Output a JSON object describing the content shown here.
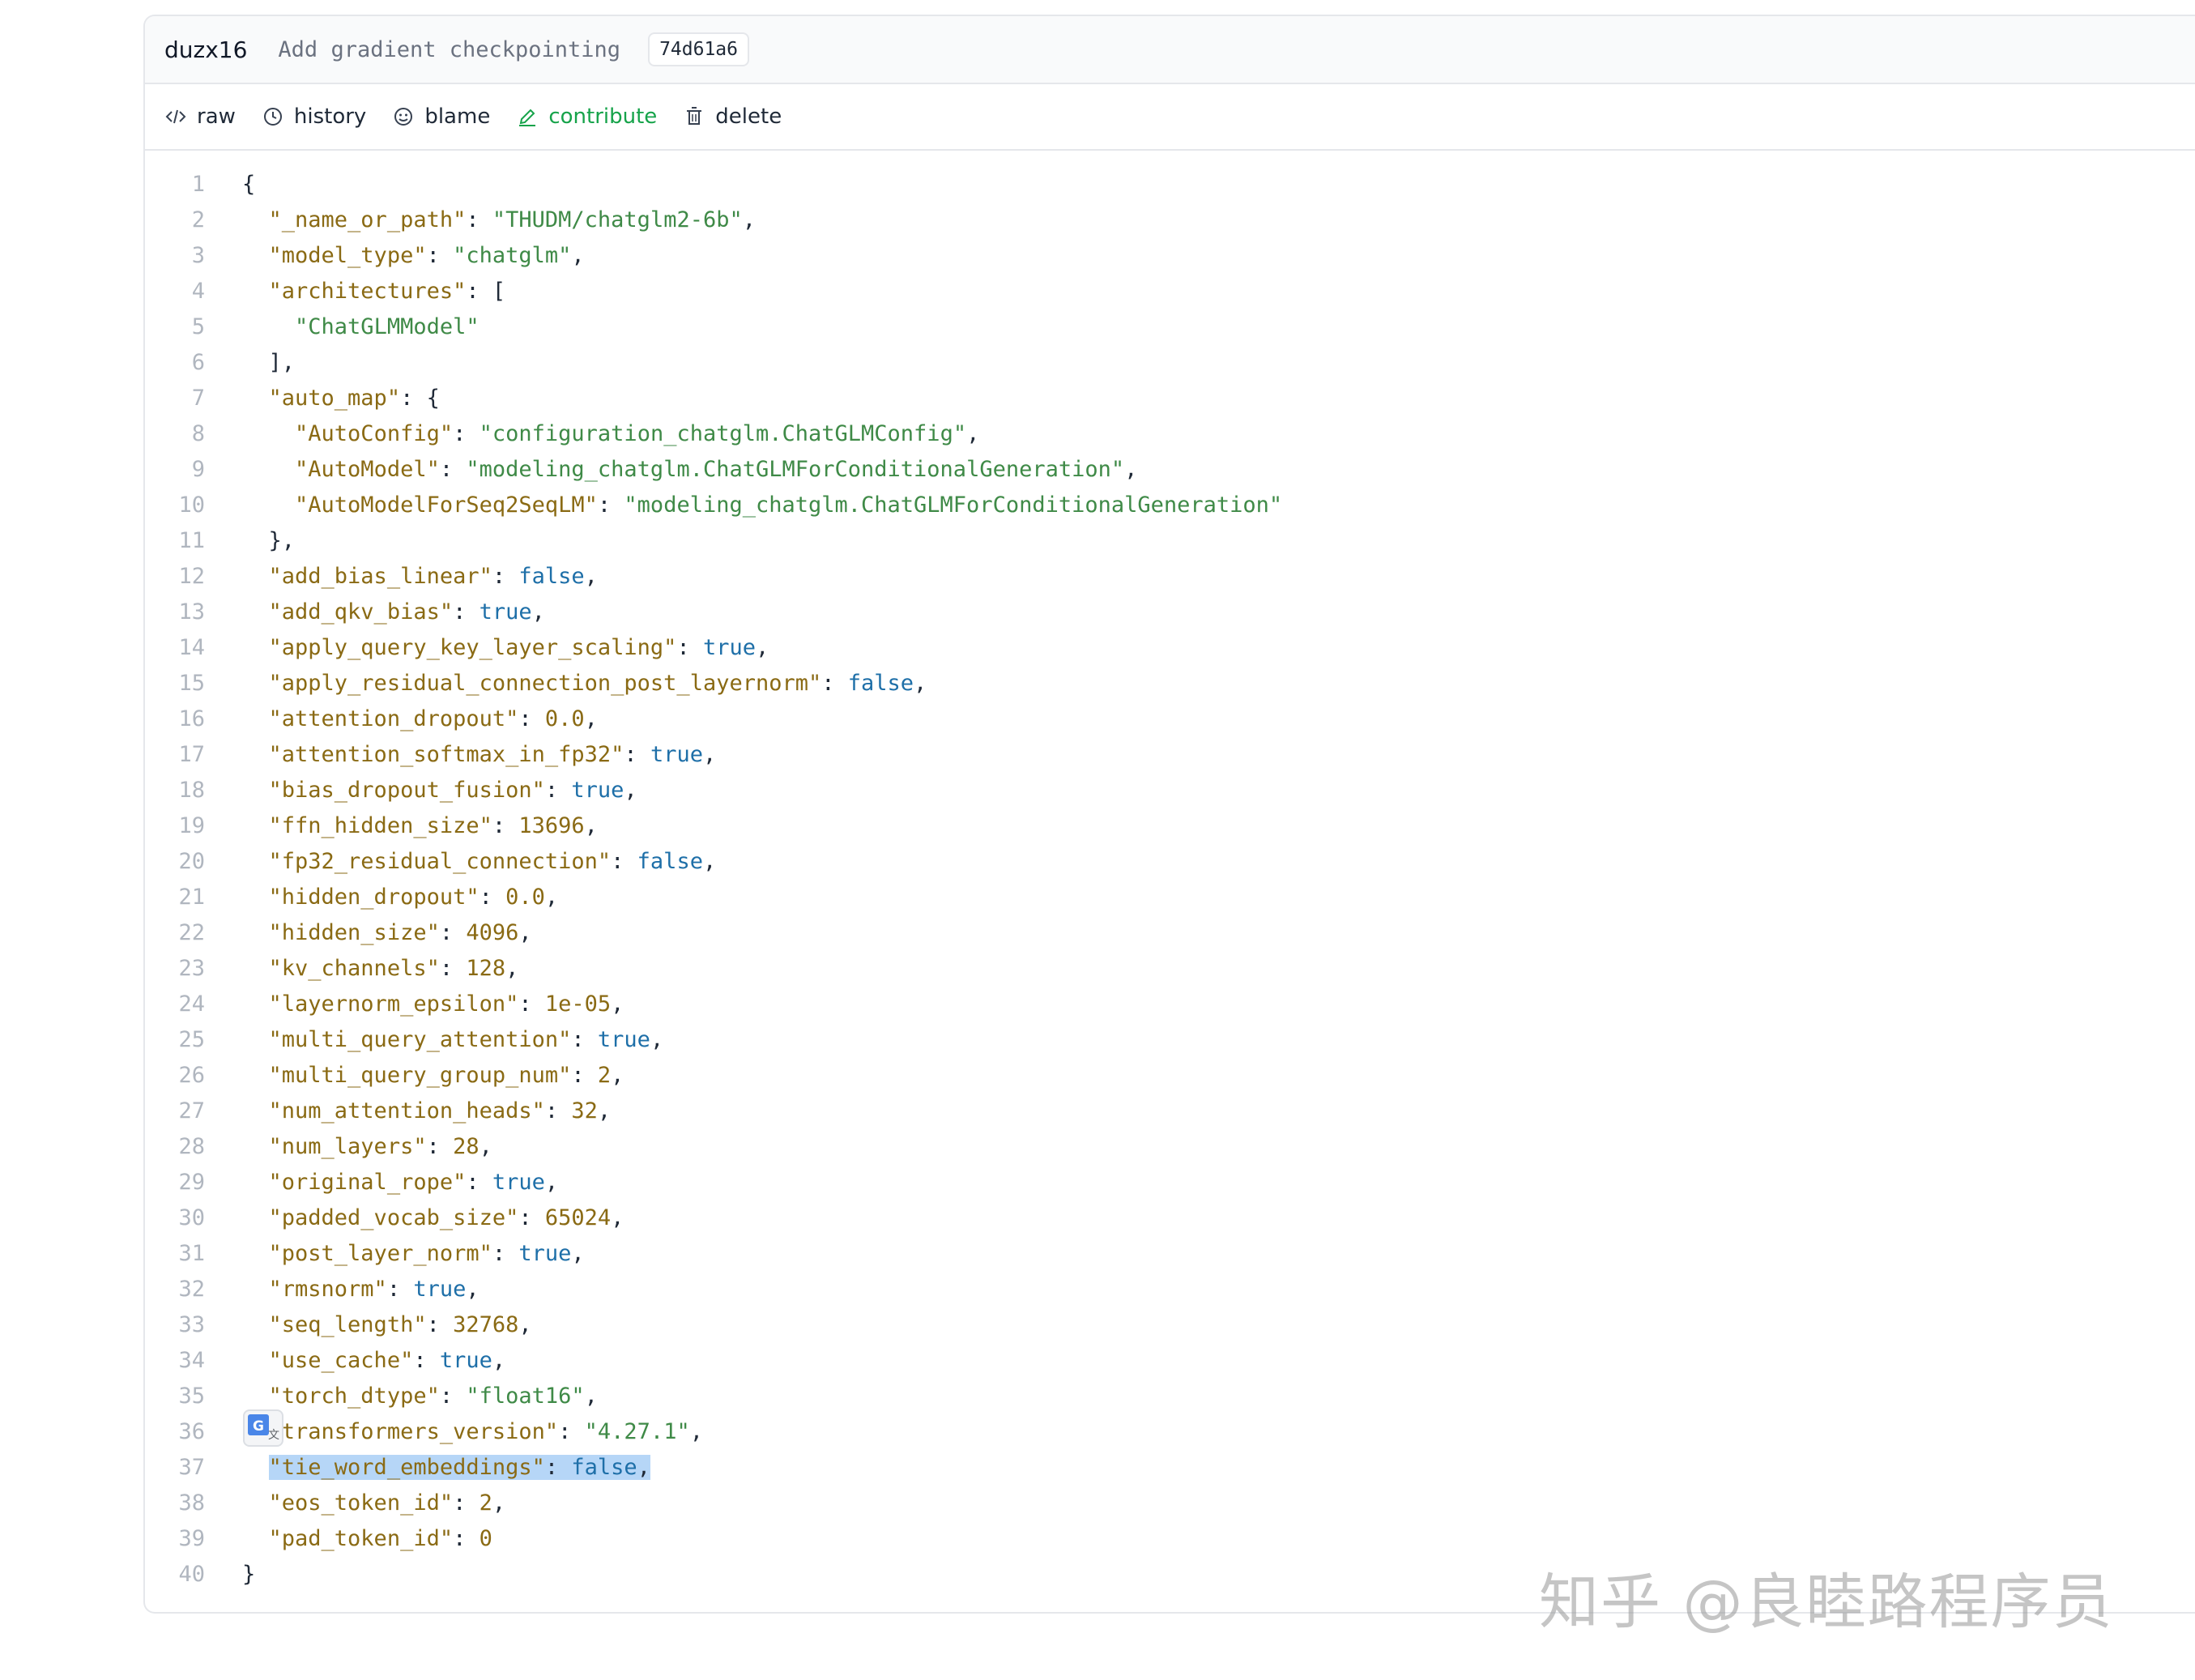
{
  "commit": {
    "author": "duzx16",
    "message": "Add gradient checkpointing",
    "sha": "74d61a6"
  },
  "actions": {
    "raw": "raw",
    "history": "history",
    "blame": "blame",
    "contribute": "contribute",
    "delete": "delete"
  },
  "colors": {
    "contribute": "#16a34a",
    "key": "#8a6a14",
    "string": "#3f8a47",
    "boolean": "#1e6fa8",
    "highlight": "#b6d6f7"
  },
  "highlighted_line": 37,
  "code_lines": [
    {
      "n": "1",
      "segs": [
        [
          "p",
          "{"
        ]
      ]
    },
    {
      "n": "2",
      "segs": [
        [
          "p",
          "  "
        ],
        [
          "k",
          "\"_name_or_path\""
        ],
        [
          "p",
          ": "
        ],
        [
          "s",
          "\"THUDM/chatglm2-6b\""
        ],
        [
          "p",
          ","
        ]
      ]
    },
    {
      "n": "3",
      "segs": [
        [
          "p",
          "  "
        ],
        [
          "k",
          "\"model_type\""
        ],
        [
          "p",
          ": "
        ],
        [
          "s",
          "\"chatglm\""
        ],
        [
          "p",
          ","
        ]
      ]
    },
    {
      "n": "4",
      "segs": [
        [
          "p",
          "  "
        ],
        [
          "k",
          "\"architectures\""
        ],
        [
          "p",
          ": ["
        ]
      ]
    },
    {
      "n": "5",
      "segs": [
        [
          "p",
          "    "
        ],
        [
          "s",
          "\"ChatGLMModel\""
        ]
      ]
    },
    {
      "n": "6",
      "segs": [
        [
          "p",
          "  ],"
        ]
      ]
    },
    {
      "n": "7",
      "segs": [
        [
          "p",
          "  "
        ],
        [
          "k",
          "\"auto_map\""
        ],
        [
          "p",
          ": {"
        ]
      ]
    },
    {
      "n": "8",
      "segs": [
        [
          "p",
          "    "
        ],
        [
          "k",
          "\"AutoConfig\""
        ],
        [
          "p",
          ": "
        ],
        [
          "s",
          "\"configuration_chatglm.ChatGLMConfig\""
        ],
        [
          "p",
          ","
        ]
      ]
    },
    {
      "n": "9",
      "segs": [
        [
          "p",
          "    "
        ],
        [
          "k",
          "\"AutoModel\""
        ],
        [
          "p",
          ": "
        ],
        [
          "s",
          "\"modeling_chatglm.ChatGLMForConditionalGeneration\""
        ],
        [
          "p",
          ","
        ]
      ]
    },
    {
      "n": "10",
      "segs": [
        [
          "p",
          "    "
        ],
        [
          "k",
          "\"AutoModelForSeq2SeqLM\""
        ],
        [
          "p",
          ": "
        ],
        [
          "s",
          "\"modeling_chatglm.ChatGLMForConditionalGeneration\""
        ]
      ]
    },
    {
      "n": "11",
      "segs": [
        [
          "p",
          "  },"
        ]
      ]
    },
    {
      "n": "12",
      "segs": [
        [
          "p",
          "  "
        ],
        [
          "k",
          "\"add_bias_linear\""
        ],
        [
          "p",
          ": "
        ],
        [
          "b",
          "false"
        ],
        [
          "p",
          ","
        ]
      ]
    },
    {
      "n": "13",
      "segs": [
        [
          "p",
          "  "
        ],
        [
          "k",
          "\"add_qkv_bias\""
        ],
        [
          "p",
          ": "
        ],
        [
          "b",
          "true"
        ],
        [
          "p",
          ","
        ]
      ]
    },
    {
      "n": "14",
      "segs": [
        [
          "p",
          "  "
        ],
        [
          "k",
          "\"apply_query_key_layer_scaling\""
        ],
        [
          "p",
          ": "
        ],
        [
          "b",
          "true"
        ],
        [
          "p",
          ","
        ]
      ]
    },
    {
      "n": "15",
      "segs": [
        [
          "p",
          "  "
        ],
        [
          "k",
          "\"apply_residual_connection_post_layernorm\""
        ],
        [
          "p",
          ": "
        ],
        [
          "b",
          "false"
        ],
        [
          "p",
          ","
        ]
      ]
    },
    {
      "n": "16",
      "segs": [
        [
          "p",
          "  "
        ],
        [
          "k",
          "\"attention_dropout\""
        ],
        [
          "p",
          ": "
        ],
        [
          "n",
          "0.0"
        ],
        [
          "p",
          ","
        ]
      ]
    },
    {
      "n": "17",
      "segs": [
        [
          "p",
          "  "
        ],
        [
          "k",
          "\"attention_softmax_in_fp32\""
        ],
        [
          "p",
          ": "
        ],
        [
          "b",
          "true"
        ],
        [
          "p",
          ","
        ]
      ]
    },
    {
      "n": "18",
      "segs": [
        [
          "p",
          "  "
        ],
        [
          "k",
          "\"bias_dropout_fusion\""
        ],
        [
          "p",
          ": "
        ],
        [
          "b",
          "true"
        ],
        [
          "p",
          ","
        ]
      ]
    },
    {
      "n": "19",
      "segs": [
        [
          "p",
          "  "
        ],
        [
          "k",
          "\"ffn_hidden_size\""
        ],
        [
          "p",
          ": "
        ],
        [
          "n",
          "13696"
        ],
        [
          "p",
          ","
        ]
      ]
    },
    {
      "n": "20",
      "segs": [
        [
          "p",
          "  "
        ],
        [
          "k",
          "\"fp32_residual_connection\""
        ],
        [
          "p",
          ": "
        ],
        [
          "b",
          "false"
        ],
        [
          "p",
          ","
        ]
      ]
    },
    {
      "n": "21",
      "segs": [
        [
          "p",
          "  "
        ],
        [
          "k",
          "\"hidden_dropout\""
        ],
        [
          "p",
          ": "
        ],
        [
          "n",
          "0.0"
        ],
        [
          "p",
          ","
        ]
      ]
    },
    {
      "n": "22",
      "segs": [
        [
          "p",
          "  "
        ],
        [
          "k",
          "\"hidden_size\""
        ],
        [
          "p",
          ": "
        ],
        [
          "n",
          "4096"
        ],
        [
          "p",
          ","
        ]
      ]
    },
    {
      "n": "23",
      "segs": [
        [
          "p",
          "  "
        ],
        [
          "k",
          "\"kv_channels\""
        ],
        [
          "p",
          ": "
        ],
        [
          "n",
          "128"
        ],
        [
          "p",
          ","
        ]
      ]
    },
    {
      "n": "24",
      "segs": [
        [
          "p",
          "  "
        ],
        [
          "k",
          "\"layernorm_epsilon\""
        ],
        [
          "p",
          ": "
        ],
        [
          "n",
          "1e-05"
        ],
        [
          "p",
          ","
        ]
      ]
    },
    {
      "n": "25",
      "segs": [
        [
          "p",
          "  "
        ],
        [
          "k",
          "\"multi_query_attention\""
        ],
        [
          "p",
          ": "
        ],
        [
          "b",
          "true"
        ],
        [
          "p",
          ","
        ]
      ]
    },
    {
      "n": "26",
      "segs": [
        [
          "p",
          "  "
        ],
        [
          "k",
          "\"multi_query_group_num\""
        ],
        [
          "p",
          ": "
        ],
        [
          "n",
          "2"
        ],
        [
          "p",
          ","
        ]
      ]
    },
    {
      "n": "27",
      "segs": [
        [
          "p",
          "  "
        ],
        [
          "k",
          "\"num_attention_heads\""
        ],
        [
          "p",
          ": "
        ],
        [
          "n",
          "32"
        ],
        [
          "p",
          ","
        ]
      ]
    },
    {
      "n": "28",
      "segs": [
        [
          "p",
          "  "
        ],
        [
          "k",
          "\"num_layers\""
        ],
        [
          "p",
          ": "
        ],
        [
          "n",
          "28"
        ],
        [
          "p",
          ","
        ]
      ]
    },
    {
      "n": "29",
      "segs": [
        [
          "p",
          "  "
        ],
        [
          "k",
          "\"original_rope\""
        ],
        [
          "p",
          ": "
        ],
        [
          "b",
          "true"
        ],
        [
          "p",
          ","
        ]
      ]
    },
    {
      "n": "30",
      "segs": [
        [
          "p",
          "  "
        ],
        [
          "k",
          "\"padded_vocab_size\""
        ],
        [
          "p",
          ": "
        ],
        [
          "n",
          "65024"
        ],
        [
          "p",
          ","
        ]
      ]
    },
    {
      "n": "31",
      "segs": [
        [
          "p",
          "  "
        ],
        [
          "k",
          "\"post_layer_norm\""
        ],
        [
          "p",
          ": "
        ],
        [
          "b",
          "true"
        ],
        [
          "p",
          ","
        ]
      ]
    },
    {
      "n": "32",
      "segs": [
        [
          "p",
          "  "
        ],
        [
          "k",
          "\"rmsnorm\""
        ],
        [
          "p",
          ": "
        ],
        [
          "b",
          "true"
        ],
        [
          "p",
          ","
        ]
      ]
    },
    {
      "n": "33",
      "segs": [
        [
          "p",
          "  "
        ],
        [
          "k",
          "\"seq_length\""
        ],
        [
          "p",
          ": "
        ],
        [
          "n",
          "32768"
        ],
        [
          "p",
          ","
        ]
      ]
    },
    {
      "n": "34",
      "segs": [
        [
          "p",
          "  "
        ],
        [
          "k",
          "\"use_cache\""
        ],
        [
          "p",
          ": "
        ],
        [
          "b",
          "true"
        ],
        [
          "p",
          ","
        ]
      ]
    },
    {
      "n": "35",
      "segs": [
        [
          "p",
          "  "
        ],
        [
          "k",
          "\"torch_dtype\""
        ],
        [
          "p",
          ": "
        ],
        [
          "s",
          "\"float16\""
        ],
        [
          "p",
          ","
        ]
      ]
    },
    {
      "n": "36",
      "segs": [
        [
          "p",
          "  "
        ],
        [
          "k",
          "\"transformers_version\""
        ],
        [
          "p",
          ": "
        ],
        [
          "s",
          "\"4.27.1\""
        ],
        [
          "p",
          ","
        ]
      ]
    },
    {
      "n": "37",
      "segs": [
        [
          "p",
          "  "
        ],
        [
          "k",
          "\"tie_word_embeddings\""
        ],
        [
          "p",
          ": "
        ],
        [
          "b",
          "false"
        ],
        [
          "p",
          ","
        ]
      ]
    },
    {
      "n": "38",
      "segs": [
        [
          "p",
          "  "
        ],
        [
          "k",
          "\"eos_token_id\""
        ],
        [
          "p",
          ": "
        ],
        [
          "n",
          "2"
        ],
        [
          "p",
          ","
        ]
      ]
    },
    {
      "n": "39",
      "segs": [
        [
          "p",
          "  "
        ],
        [
          "k",
          "\"pad_token_id\""
        ],
        [
          "p",
          ": "
        ],
        [
          "n",
          "0"
        ]
      ]
    },
    {
      "n": "40",
      "segs": [
        [
          "p",
          "}"
        ]
      ]
    }
  ],
  "translate_badge": {
    "icon": "google-translate-icon"
  },
  "watermark": "知乎 @良睦路程序员"
}
